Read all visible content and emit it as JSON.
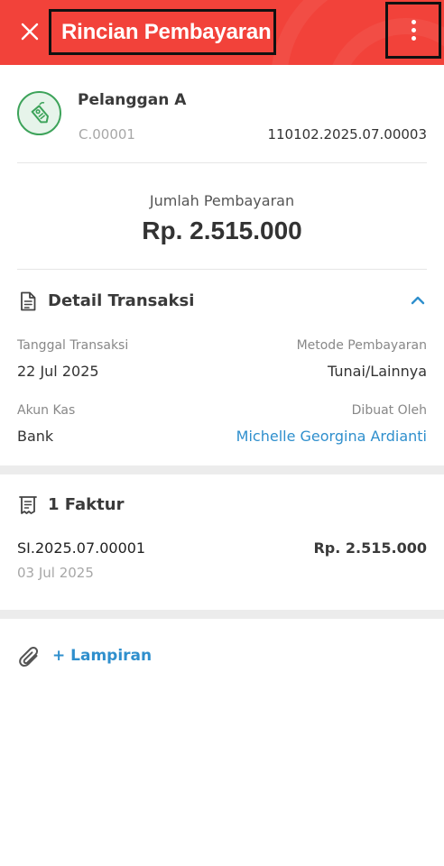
{
  "header": {
    "title": "Rincian Pembayaran",
    "close_icon": "close-icon",
    "menu_icon": "more-vertical-icon",
    "color": "#f2423a"
  },
  "customer": {
    "name": "Pelanggan A",
    "code": "C.00001",
    "transaction_number": "110102.2025.07.00003",
    "icon": "price-tag-icon"
  },
  "payment": {
    "amount_label": "Jumlah Pembayaran",
    "amount_value": "Rp. 2.515.000"
  },
  "detail_section": {
    "title": "Detail Transaksi",
    "icon": "document-icon",
    "toggle_icon": "chevron-up-icon",
    "fields": {
      "transaction_date_label": "Tanggal Transaksi",
      "transaction_date_value": "22 Jul 2025",
      "payment_method_label": "Metode Pembayaran",
      "payment_method_value": "Tunai/Lainnya",
      "cash_account_label": "Akun Kas",
      "cash_account_value": "Bank",
      "created_by_label": "Dibuat Oleh",
      "created_by_value": "Michelle Georgina Ardianti"
    }
  },
  "invoice_section": {
    "title": "1 Faktur",
    "icon": "receipt-icon",
    "items": [
      {
        "number": "SI.2025.07.00001",
        "date": "03 Jul 2025",
        "amount": "Rp. 2.515.000"
      }
    ]
  },
  "attachment": {
    "label": "+ Lampiran",
    "icon": "paperclip-icon"
  },
  "colors": {
    "accent": "#2f8fcd",
    "brand": "#f2423a",
    "customer_icon": "#3da35a"
  }
}
